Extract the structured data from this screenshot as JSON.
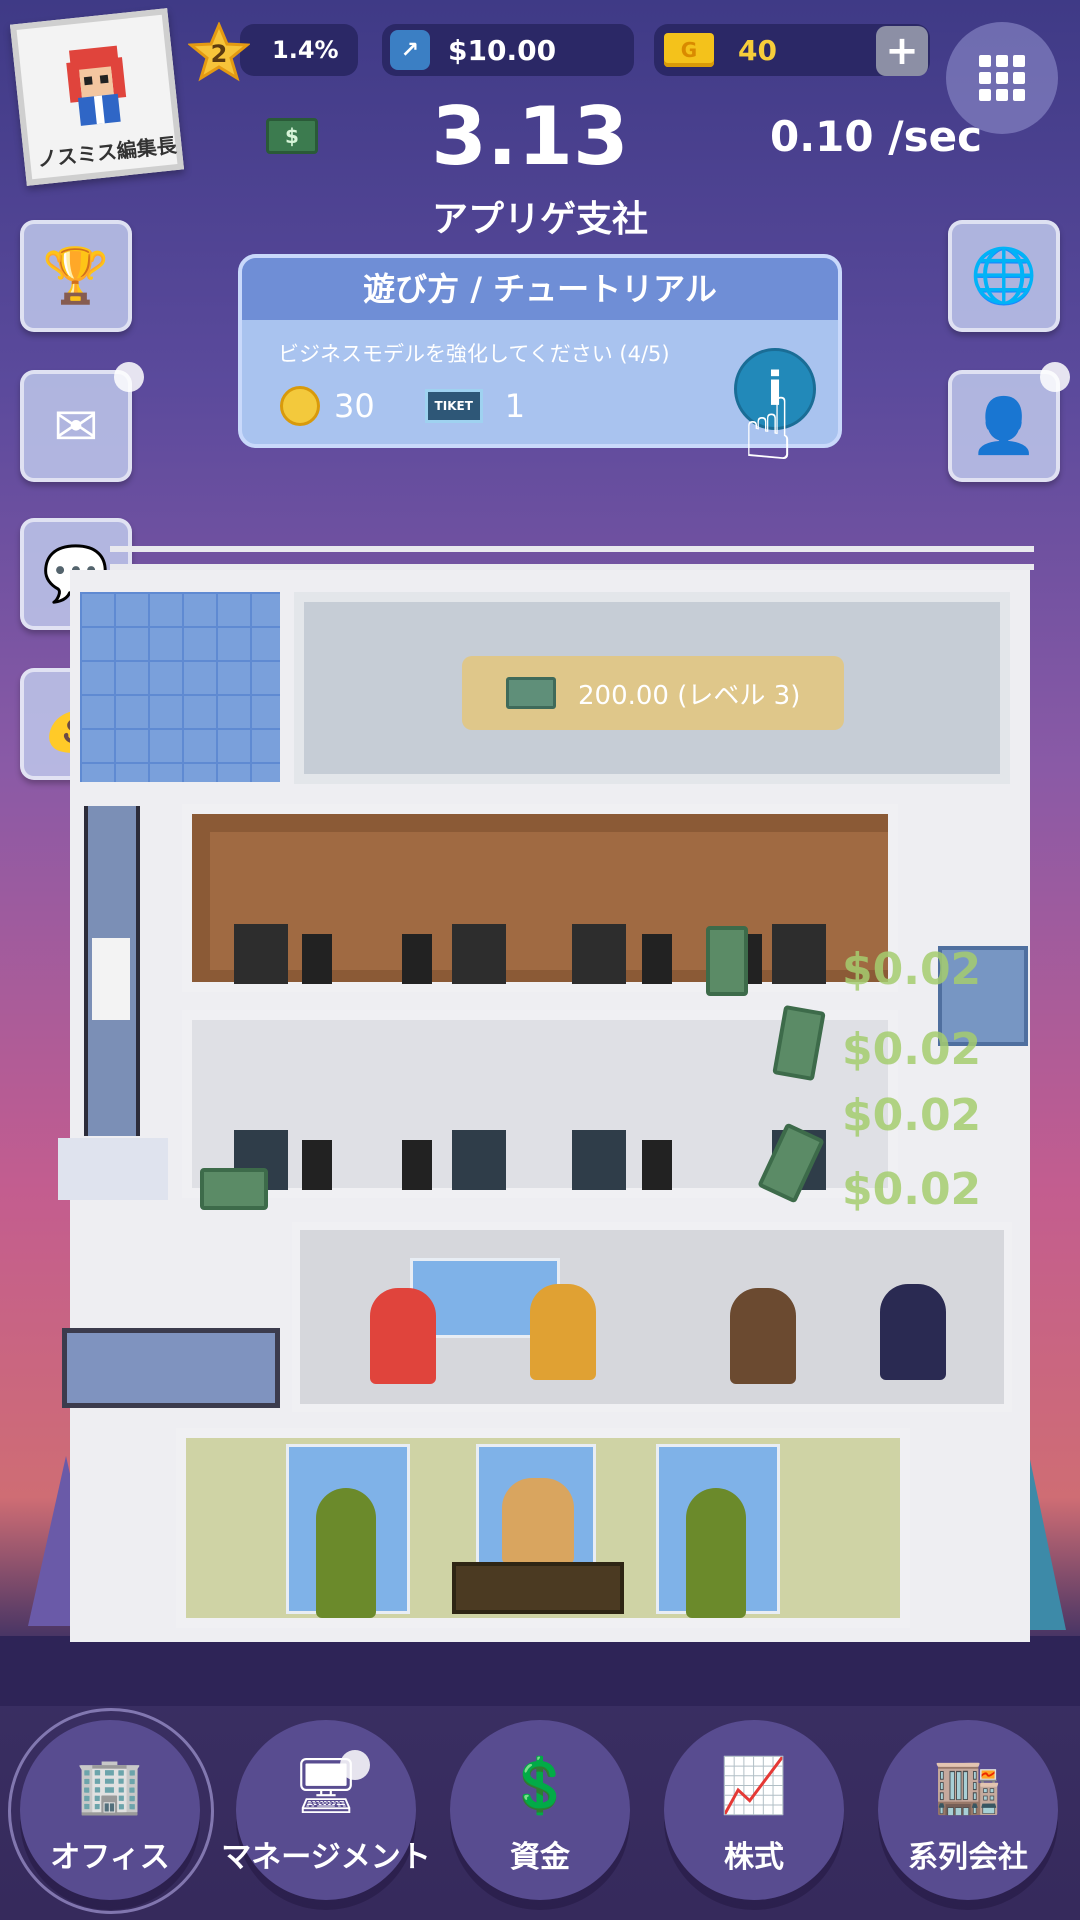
{
  "profile": {
    "name": "ノスミス編集長"
  },
  "stats": {
    "level": "2",
    "level_progress": "1.4%",
    "cash": "$10.00",
    "gold": "40",
    "gold_icon_letter": "G",
    "plus": "+"
  },
  "main": {
    "money": "3.13",
    "rate": "0.10 /sec",
    "company": "アプリゲ支社"
  },
  "tutorial": {
    "title": "遊び方 / チュートリアル",
    "description": "ビジネスモデルを強化してください (4/5)",
    "reward_coins": "30",
    "reward_ticket_label": "TIKET",
    "reward_tickets": "1",
    "info_glyph": "i"
  },
  "building": {
    "upgrade_label": "200.00 (レベル 3)",
    "money_floats": [
      "$0.02",
      "$0.02",
      "$0.02",
      "$0.02"
    ]
  },
  "side_buttons_left": [
    {
      "icon": "trophy-icon",
      "glyph": "🏆"
    },
    {
      "icon": "mail-icon",
      "glyph": "✉"
    },
    {
      "icon": "chat-icon",
      "glyph": "💬"
    },
    {
      "icon": "treasure-icon",
      "glyph": "💰"
    }
  ],
  "side_buttons_right": [
    {
      "icon": "globe-icon",
      "glyph": "🌐"
    },
    {
      "icon": "character-icon",
      "glyph": "👤"
    }
  ],
  "nav": [
    {
      "label": "オフィス",
      "icon": "office-building-icon",
      "glyph": "🏢"
    },
    {
      "label": "マネージメント",
      "icon": "monitor-icon",
      "glyph": "🖥"
    },
    {
      "label": "資金",
      "icon": "dollar-coin-icon",
      "glyph": "💲"
    },
    {
      "label": "株式",
      "icon": "stock-chart-icon",
      "glyph": "📈"
    },
    {
      "label": "系列会社",
      "icon": "affiliates-building-icon",
      "glyph": "🏬"
    }
  ],
  "colors": {
    "accent_blue": "#6f8ed6",
    "gold": "#f7cd3a",
    "money_green": "#a5cd6e"
  }
}
